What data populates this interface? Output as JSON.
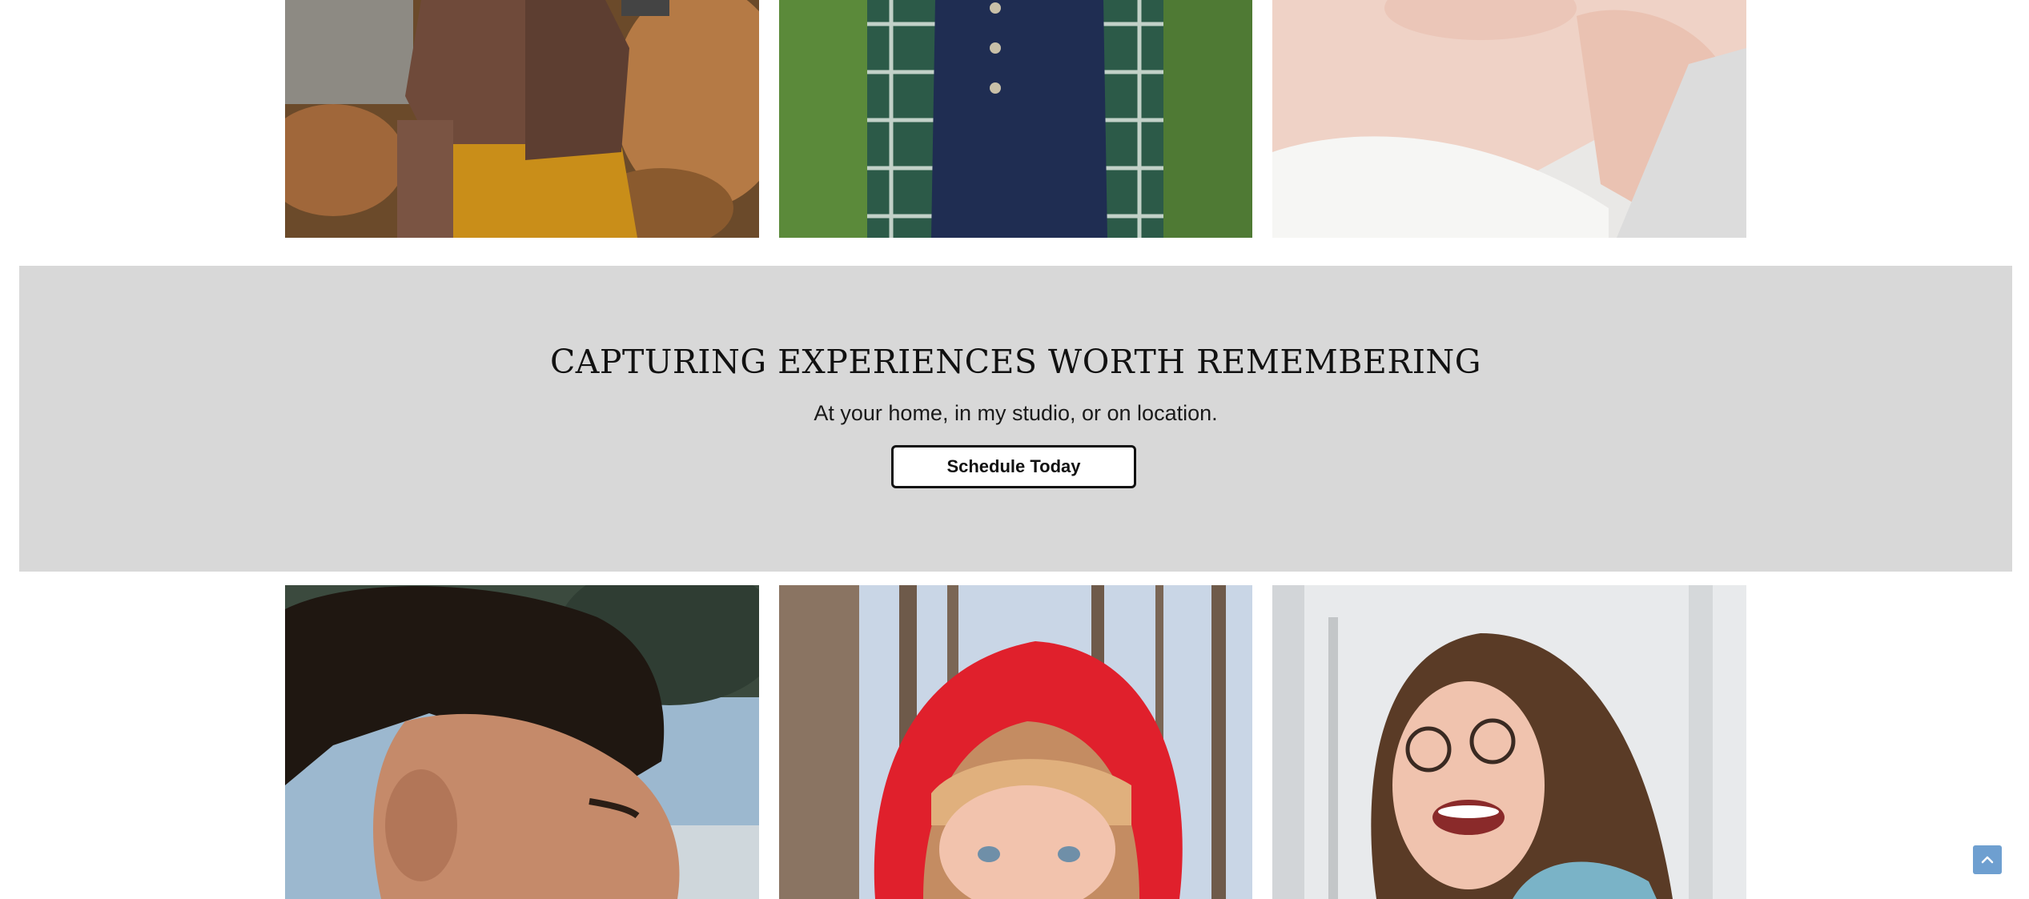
{
  "cta": {
    "title": "CAPTURING EXPERIENCES WORTH REMEMBERING",
    "subtitle": "At your home, in my studio, or on location.",
    "button_label": "Schedule Today"
  },
  "gallery": {
    "top_row": [
      "boy-in-autumn-leaves-photo",
      "boy-in-plaid-shirt-photo",
      "newborn-baby-photo"
    ],
    "bottom_row": [
      "young-man-profile-photo",
      "child-in-red-hood-photo",
      "girl-laughing-in-snow-photo"
    ]
  },
  "scroll_top": {
    "icon": "chevron-up-icon"
  },
  "colors": {
    "band": "#d8d8d8",
    "scroll_button": "#6e9fd0"
  }
}
